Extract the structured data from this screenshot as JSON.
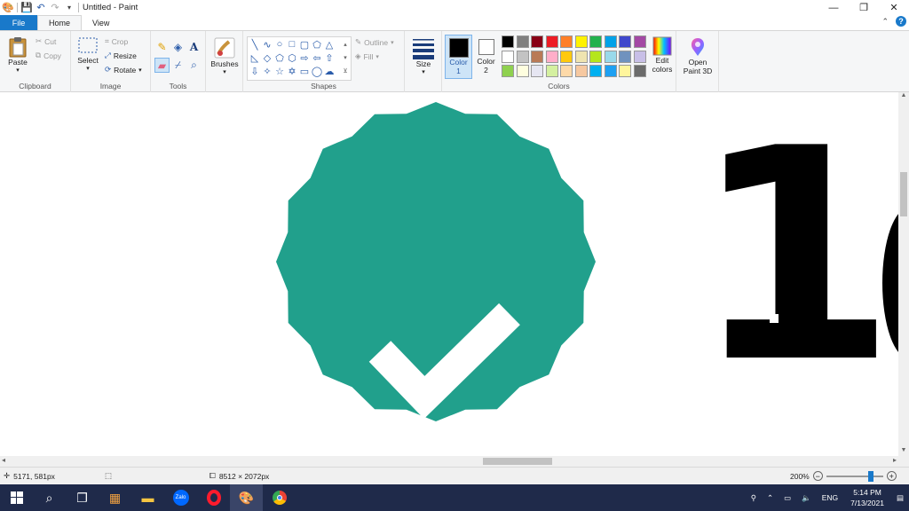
{
  "window": {
    "title": "Untitled - Paint"
  },
  "tabs": {
    "file": "File",
    "home": "Home",
    "view": "View"
  },
  "ribbon": {
    "clipboard": {
      "paste": "Paste",
      "cut": "Cut",
      "copy": "Copy",
      "label": "Clipboard"
    },
    "image": {
      "select": "Select",
      "crop": "Crop",
      "resize": "Resize",
      "rotate": "Rotate",
      "label": "Image"
    },
    "tools": {
      "label": "Tools"
    },
    "brushes": {
      "label": "Brushes"
    },
    "shapes": {
      "outline": "Outline",
      "fill": "Fill",
      "label": "Shapes"
    },
    "size": {
      "label": "Size"
    },
    "colors": {
      "color1": "Color",
      "color1_num": "1",
      "color2": "Color",
      "color2_num": "2",
      "edit": "Edit",
      "edit2": "colors",
      "label": "Colors",
      "color1_value": "#000000",
      "color2_value": "#ffffff",
      "palette": [
        [
          "#000000",
          "#7f7f7f",
          "#880015",
          "#ed1c24",
          "#ff7f27",
          "#fff200",
          "#22b14c",
          "#00a2e8",
          "#3f48cc",
          "#a349a4"
        ],
        [
          "#ffffff",
          "#c3c3c3",
          "#b97a57",
          "#ffaec9",
          "#ffc90e",
          "#efe4b0",
          "#b5e61d",
          "#99d9ea",
          "#7092be",
          "#c8bfe7"
        ],
        [
          "#8fd14f",
          "#fefedf",
          "#e6e6f2",
          "#d4f0a0",
          "#fdd9a8",
          "#f6c8a0",
          "#00b0f0",
          "#1ea0f2",
          "#fff59d",
          "#6b6b6b"
        ]
      ]
    },
    "paint3d": {
      "line1": "Open",
      "line2": "Paint 3D"
    }
  },
  "canvas": {
    "badge_color": "#21a08c",
    "glyph": "1"
  },
  "status": {
    "cursor": "5171, 581px",
    "image_size": "8512 × 2072px",
    "zoom": "200%"
  },
  "taskbar": {
    "lang": "ENG",
    "time": "5:14 PM",
    "date": "7/13/2021",
    "zalo": "Zalo"
  }
}
